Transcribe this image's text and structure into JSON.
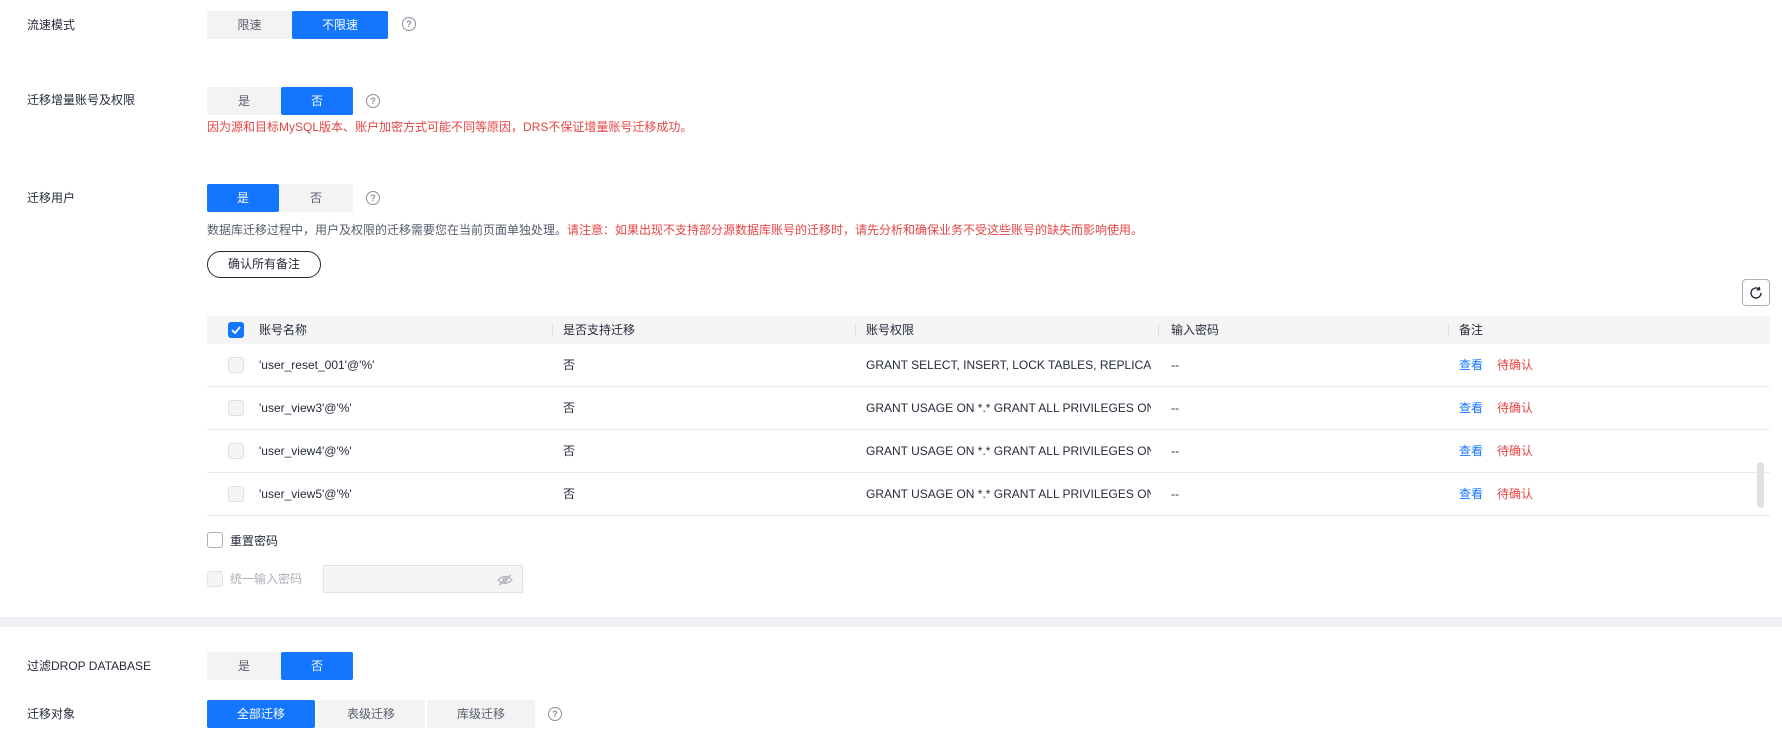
{
  "flow_mode": {
    "label": "流速模式",
    "options": [
      "限速",
      "不限速"
    ],
    "selected": "不限速",
    "help_icon": "?"
  },
  "migrate_incremental_accounts": {
    "label": "迁移增量账号及权限",
    "options": [
      "是",
      "否"
    ],
    "selected": "否",
    "help_icon": "?",
    "warning": "因为源和目标MySQL版本、账户加密方式可能不同等原因，DRS不保证增量账号迁移成功。"
  },
  "migrate_users": {
    "label": "迁移用户",
    "options": [
      "是",
      "否"
    ],
    "selected": "是",
    "help_icon": "?",
    "description": "数据库迁移过程中，用户及权限的迁移需要您在当前页面单独处理。",
    "description_warning": "请注意：如果出现不支持部分源数据库账号的迁移时，请先分析和确保业务不受这些账号的缺失而影响使用。",
    "confirm_all_button": "确认所有备注"
  },
  "user_table": {
    "columns": [
      "账号名称",
      "是否支持迁移",
      "账号权限",
      "输入密码",
      "备注"
    ],
    "rows": [
      {
        "name": "'user_reset_001'@'%'",
        "supported": "否",
        "privileges": "GRANT SELECT, INSERT, LOCK TABLES, REPLICATI...",
        "password": "--",
        "view": "查看",
        "status": "待确认"
      },
      {
        "name": "'user_view3'@'%'",
        "supported": "否",
        "privileges": "GRANT USAGE ON *.* GRANT ALL PRIVILEGES ON...",
        "password": "--",
        "view": "查看",
        "status": "待确认"
      },
      {
        "name": "'user_view4'@'%'",
        "supported": "否",
        "privileges": "GRANT USAGE ON *.* GRANT ALL PRIVILEGES ON...",
        "password": "--",
        "view": "查看",
        "status": "待确认"
      },
      {
        "name": "'user_view5'@'%'",
        "supported": "否",
        "privileges": "GRANT USAGE ON *.* GRANT ALL PRIVILEGES ON...",
        "password": "--",
        "view": "查看",
        "status": "待确认"
      }
    ]
  },
  "reset_password": {
    "label": "重置密码"
  },
  "unified_password": {
    "label": "统一输入密码"
  },
  "filter_drop_database": {
    "label": "过滤DROP DATABASE",
    "options": [
      "是",
      "否"
    ],
    "selected": "否"
  },
  "migrate_objects": {
    "label": "迁移对象",
    "options": [
      "全部迁移",
      "表级迁移",
      "库级迁移"
    ],
    "selected": "全部迁移",
    "help_icon": "?"
  },
  "colors": {
    "primary": "#1476ff",
    "danger": "#e54545",
    "warning_text": "#f66f6a"
  }
}
